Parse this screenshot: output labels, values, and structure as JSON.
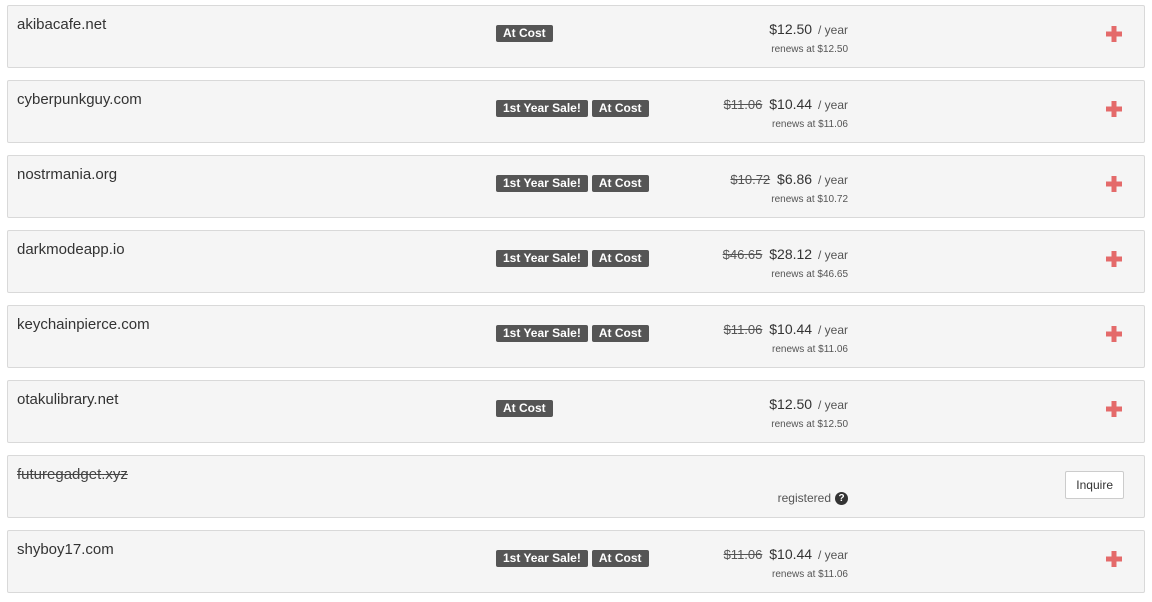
{
  "colors": {
    "badge_bg": "#555555",
    "plus_icon": "#e46a6a",
    "row_bg": "#f5f5f5"
  },
  "rows": [
    {
      "domain": "akibacafe.net",
      "badges": [
        "At Cost"
      ],
      "old_price": "",
      "price": "$12.50",
      "unit": "/ year",
      "renews": "renews at $12.50"
    },
    {
      "domain": "cyberpunkguy.com",
      "badges": [
        "1st Year Sale!",
        "At Cost"
      ],
      "old_price": "$11.06",
      "price": "$10.44",
      "unit": "/ year",
      "renews": "renews at $11.06"
    },
    {
      "domain": "nostrmania.org",
      "badges": [
        "1st Year Sale!",
        "At Cost"
      ],
      "old_price": "$10.72",
      "price": "$6.86",
      "unit": "/ year",
      "renews": "renews at $10.72"
    },
    {
      "domain": "darkmodeapp.io",
      "badges": [
        "1st Year Sale!",
        "At Cost"
      ],
      "old_price": "$46.65",
      "price": "$28.12",
      "unit": "/ year",
      "renews": "renews at $46.65"
    },
    {
      "domain": "keychainpierce.com",
      "badges": [
        "1st Year Sale!",
        "At Cost"
      ],
      "old_price": "$11.06",
      "price": "$10.44",
      "unit": "/ year",
      "renews": "renews at $11.06"
    },
    {
      "domain": "otakulibrary.net",
      "badges": [
        "At Cost"
      ],
      "old_price": "",
      "price": "$12.50",
      "unit": "/ year",
      "renews": "renews at $12.50"
    },
    {
      "domain": "futuregadget.xyz",
      "status": "registered",
      "help_icon": "question-circle-icon",
      "button": "Inquire"
    },
    {
      "domain": "shyboy17.com",
      "badges": [
        "1st Year Sale!",
        "At Cost"
      ],
      "old_price": "$11.06",
      "price": "$10.44",
      "unit": "/ year",
      "renews": "renews at $11.06"
    }
  ]
}
